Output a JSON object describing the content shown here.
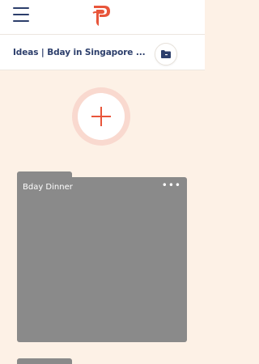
{
  "header": {
    "menu_icon": "hamburger-icon",
    "logo_icon": "p-logo-icon",
    "brand_color": "#e8553a"
  },
  "breadcrumb": {
    "text": "Ideas | Bday in Singapore ...",
    "folder_icon": "folder-icon"
  },
  "add_button": {
    "icon": "plus-icon"
  },
  "cards": [
    {
      "title": "Bday Dinner",
      "more_icon": "more-dots-icon",
      "more_text": "•••"
    }
  ]
}
